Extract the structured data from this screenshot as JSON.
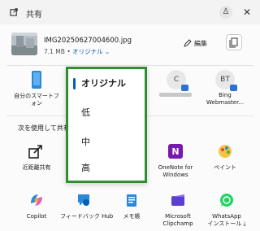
{
  "window": {
    "title": "共有"
  },
  "file": {
    "name": "IMG20250627004600.jpg",
    "size": "7.1 MB",
    "separator": "•",
    "quality": "オリジナル ⌄",
    "edit_label": "編集"
  },
  "nearby": [
    {
      "label": "自分のスマートフォン"
    },
    {
      "initials": "C"
    },
    {
      "initials": "BT",
      "label": "Bing Webmaster..."
    }
  ],
  "section_heading": "次を使用して共有",
  "apps_row1": [
    {
      "label": "近距離共有"
    },
    {
      "label": "OneNote for Windows"
    },
    {
      "label": "ペイント"
    }
  ],
  "apps_row2": [
    {
      "label": "Copilot"
    },
    {
      "label": "フィードバック Hub"
    },
    {
      "label": "メモ帳"
    },
    {
      "label": "Microsoft Clipchamp"
    },
    {
      "label": "WhatsApp",
      "sublabel": "インストール ⤓"
    }
  ],
  "quality_menu": {
    "options": [
      "オリジナル",
      "低",
      "中",
      "高"
    ],
    "selected": "オリジナル"
  },
  "colors": {
    "accent": "#005fb8",
    "highlight_border": "#2f8f2f"
  }
}
